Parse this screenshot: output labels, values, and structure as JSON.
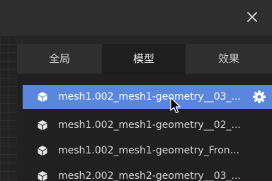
{
  "tabs": [
    {
      "label": "全局",
      "active": false
    },
    {
      "label": "模型",
      "active": true
    },
    {
      "label": "效果",
      "active": false
    }
  ],
  "list": {
    "items": [
      {
        "label": "mesh1.002_mesh1-geometry__03_...",
        "selected": true,
        "icon": "cube-icon"
      },
      {
        "label": "mesh1.002_mesh1-geometry__02_...",
        "selected": false,
        "icon": "cube-icon"
      },
      {
        "label": "mesh1.002_mesh1-geometry_Fron...",
        "selected": false,
        "icon": "cube-icon"
      },
      {
        "label": "mesh2.002_mesh2-geometry__03_...",
        "selected": false,
        "icon": "cube-icon"
      }
    ]
  },
  "colors": {
    "selected_bg": "#5a86de",
    "panel_bg": "#202020",
    "tabbar_bg": "#2f2f2f"
  }
}
